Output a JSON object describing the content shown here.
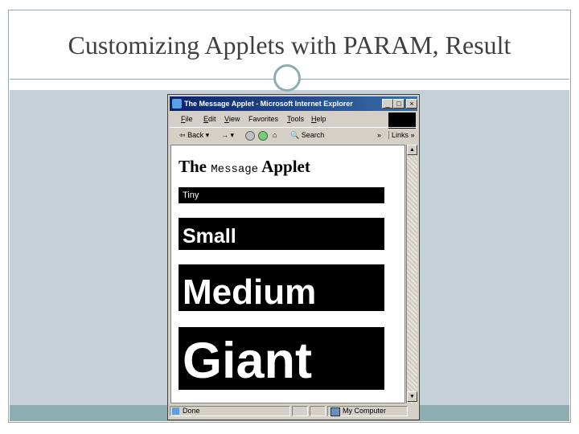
{
  "slide": {
    "title": "Customizing Applets with PARAM, Result",
    "colors": {
      "band": "#8eadb1",
      "content_bg": "#c5d1d7",
      "title_text": "#404040"
    }
  },
  "browser": {
    "window_title": "The Message Applet - Microsoft Internet Explorer",
    "window_buttons": [
      "_",
      "□",
      "×"
    ],
    "menu": [
      {
        "accel": "F",
        "rest": "ile"
      },
      {
        "accel": "E",
        "rest": "dit"
      },
      {
        "accel": "V",
        "rest": "iew"
      },
      {
        "accel": "F",
        "rest": "avorites",
        "accel_after": "a",
        "full": "Favorites"
      },
      {
        "accel": "T",
        "rest": "ools"
      },
      {
        "accel": "H",
        "rest": "elp"
      }
    ],
    "toolbar": {
      "back_label": "Back",
      "search_label": "Search",
      "links_label": "Links",
      "more": "»"
    },
    "icons": [
      "back-arrow-icon",
      "forward-arrow-icon",
      "stop-icon",
      "refresh-icon",
      "home-icon",
      "search-icon",
      "windows-logo-icon",
      "ie-page-icon",
      "my-computer-icon"
    ],
    "status": {
      "left": "Done",
      "zone": "My Computer"
    }
  },
  "page": {
    "heading_pre": "The",
    "heading_code": "Message",
    "heading_post": "Applet",
    "applets": [
      {
        "label": "Tiny"
      },
      {
        "label": "Small"
      },
      {
        "label": "Medium"
      },
      {
        "label": "Giant"
      }
    ]
  }
}
